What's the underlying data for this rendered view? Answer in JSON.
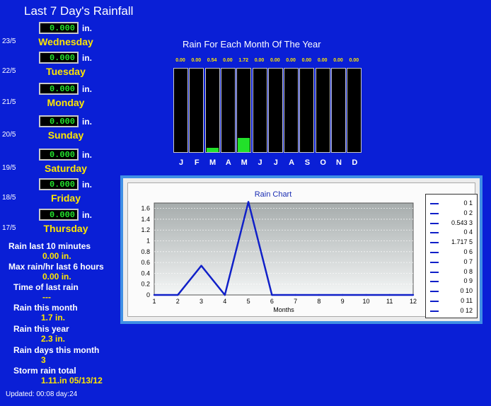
{
  "left_title": "Last 7 Day's Rainfall",
  "days": [
    {
      "date": "23/5",
      "value": "0.000",
      "unit": "in.",
      "name": "Wednesday"
    },
    {
      "date": "22/5",
      "value": "0.000",
      "unit": "in.",
      "name": "Tuesday"
    },
    {
      "date": "21/5",
      "value": "0.000",
      "unit": "in.",
      "name": "Monday"
    },
    {
      "date": "20/5",
      "value": "0.000",
      "unit": "in.",
      "name": "Sunday"
    },
    {
      "date": "19/5",
      "value": "0.000",
      "unit": "in.",
      "name": "Saturday"
    },
    {
      "date": "18/5",
      "value": "0.000",
      "unit": "in.",
      "name": "Friday"
    },
    {
      "date": "17/5",
      "value": "0.000",
      "unit": "in.",
      "name": "Thursday"
    }
  ],
  "stats": {
    "last10_label": "Rain last 10 minutes",
    "last10_value": "0.00 in.",
    "maxhr_label": "Max rain/hr last 6 hours",
    "maxhr_value": "0.00 in.",
    "lasttime_label": "Time of last rain",
    "lasttime_value": "---",
    "month_label": "Rain this month",
    "month_value": "1.7 in.",
    "year_label": "Rain this year",
    "year_value": "2.3 in.",
    "days_label": "Rain days this month",
    "days_value": "3",
    "storm_label": "Storm rain total",
    "storm_value": "1.11.in 05/13/12"
  },
  "updated": "Updated: 00:08 day:24",
  "monthly": {
    "title": "Rain For Each Month Of The Year",
    "labels": [
      "J",
      "F",
      "M",
      "A",
      "M",
      "J",
      "J",
      "A",
      "S",
      "O",
      "N",
      "D"
    ],
    "values": [
      "0.00",
      "0.00",
      "0.54",
      "0.00",
      "1.72",
      "0.00",
      "0.00",
      "0.00",
      "0.00",
      "0.00",
      "0.00",
      "0.00"
    ],
    "max": 10,
    "fill_color": "#22e12a"
  },
  "chart_data": {
    "type": "line",
    "title": "Rain Chart",
    "xlabel": "Months",
    "ylabel": "",
    "x": [
      1,
      2,
      3,
      4,
      5,
      6,
      7,
      8,
      9,
      10,
      11,
      12
    ],
    "series": [
      {
        "values": [
          0,
          0,
          0.54,
          0,
          1.72,
          0,
          0,
          0,
          0,
          0,
          0,
          0
        ],
        "color": "#1020c8"
      }
    ],
    "xlim": [
      1,
      12
    ],
    "ylim": [
      0,
      1.7
    ],
    "yticks": [
      "0",
      "0.2",
      "0.4",
      "0.6",
      "0.8",
      "1",
      "1.2",
      "1.4",
      "1.6"
    ],
    "xticks": [
      "1",
      "2",
      "3",
      "4",
      "5",
      "6",
      "7",
      "8",
      "9",
      "10",
      "11",
      "12"
    ],
    "grid": true,
    "legend_position": "right",
    "legend_entries": [
      "0 1",
      "0 2",
      "0.543 3",
      "0 4",
      "1.717 5",
      "0 6",
      "0 7",
      "0 8",
      "0 9",
      "0 10",
      "0 11",
      "0 12"
    ]
  }
}
